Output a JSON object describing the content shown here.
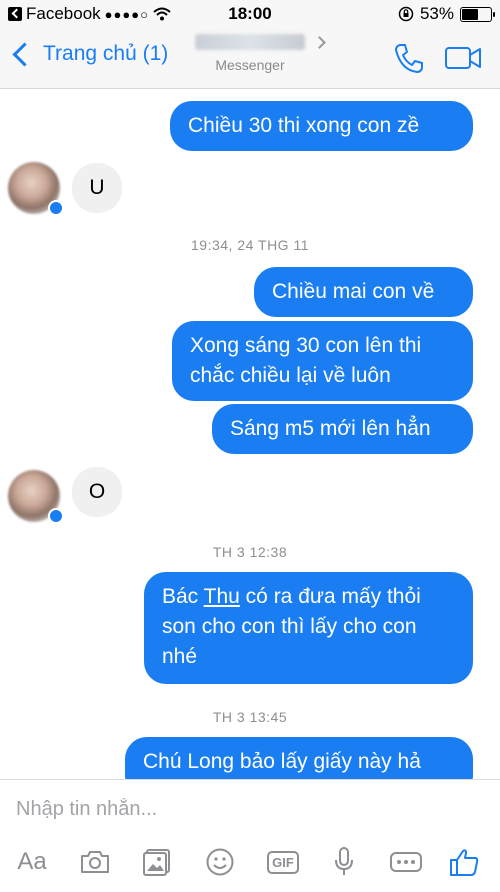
{
  "status_bar": {
    "carrier": "Facebook",
    "time": "18:00",
    "battery": "53%",
    "battery_level": 0.53
  },
  "nav": {
    "back_label": "Trang chủ (1)",
    "subtitle": "Messenger"
  },
  "messages": {
    "m1": "Chiều 30 thi xong con zề",
    "m2": "U",
    "ts1": "19:34, 24 THG 11",
    "m3": "Chiều mai con về",
    "m4_line1": "Xong sáng 30 con lên thi",
    "m4_line2": "chắc chiều lại về luôn",
    "m5": "Sáng m5 mới lên hẳn",
    "m6": "O",
    "ts2": "TH 3 12:38",
    "m7_a": "Bác ",
    "m7_link": "Thu",
    "m7_b": " có ra đưa mấy thỏi",
    "m7_line2": "son cho con thì lấy cho con",
    "m7_line3": "nhé",
    "ts3": "TH 3 13:45",
    "m8": "Chú Long bảo lấy giấy này hả"
  },
  "composer": {
    "placeholder": "Nhập tin nhắn...",
    "aa_label": "Aa",
    "gif_label": "GIF"
  },
  "colors": {
    "accent": "#1a7ef2",
    "incoming_bubble": "#f0f0f0"
  }
}
